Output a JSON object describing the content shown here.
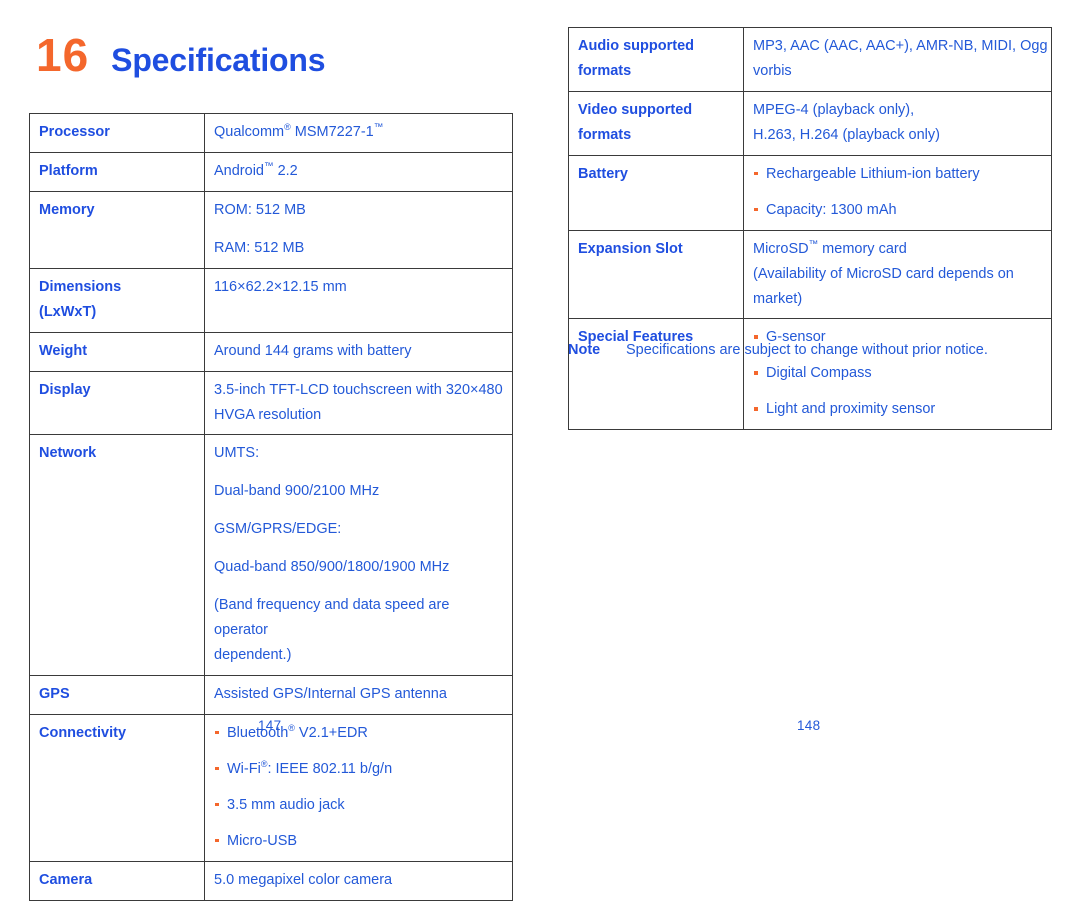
{
  "chapter": {
    "number": "16",
    "title": "Specifications",
    "number_color": "#f4672c",
    "title_color": "#1f4ee0"
  },
  "theme": {
    "text_blue": "#2359d8",
    "label_blue": "#1f4ee0",
    "accent_orange": "#f4672c",
    "border": "#3a3a3a"
  },
  "left_table": {
    "rows": [
      {
        "label": "Processor",
        "lines": [
          "Qualcomm® MSM7227-1™"
        ]
      },
      {
        "label": "Platform",
        "lines": [
          "Android™ 2.2"
        ]
      },
      {
        "label": "Memory",
        "lines": [
          "ROM: 512 MB",
          "RAM: 512 MB"
        ]
      },
      {
        "label": "Dimensions (LxWxT)",
        "label_line1": "Dimensions",
        "label_line2": "(LxWxT)",
        "lines": [
          "116×62.2×12.15 mm"
        ]
      },
      {
        "label": "Weight",
        "lines": [
          "Around 144 grams with battery"
        ]
      },
      {
        "label": "Display",
        "lines": [
          "3.5-inch TFT-LCD touchscreen with 320×480",
          "HVGA resolution"
        ]
      },
      {
        "label": "Network",
        "lines": [
          "UMTS:",
          "Dual-band 900/2100 MHz",
          "GSM/GPRS/EDGE:",
          "Quad-band 850/900/1800/1900 MHz",
          "(Band frequency and data speed are operator",
          "dependent.)"
        ]
      },
      {
        "label": "GPS",
        "lines": [
          "Assisted GPS/Internal GPS antenna"
        ]
      },
      {
        "label": "Connectivity",
        "bullets": [
          "Bluetooth® V2.1+EDR",
          "Wi-Fi®: IEEE 802.11 b/g/n",
          "3.5 mm audio jack",
          "Micro-USB"
        ]
      },
      {
        "label": "Camera",
        "lines": [
          "5.0 megapixel color camera"
        ]
      }
    ]
  },
  "right_table": {
    "rows": [
      {
        "label": "Audio supported formats",
        "label_line1": "Audio supported",
        "label_line2": "formats",
        "lines": [
          "MP3, AAC  (AAC, AAC+), AMR-NB, MIDI, Ogg",
          "vorbis"
        ]
      },
      {
        "label": "Video supported formats",
        "label_line1": "Video supported",
        "label_line2": "formats",
        "lines": [
          "MPEG-4 (playback only),",
          "H.263, H.264 (playback only)"
        ]
      },
      {
        "label": "Battery",
        "bullets": [
          "Rechargeable Lithium-ion battery",
          "Capacity: 1300 mAh"
        ]
      },
      {
        "label": "Expansion Slot",
        "lines": [
          "MicroSD™ memory card",
          "(Availability of MicroSD card depends on",
          "market)"
        ]
      },
      {
        "label": "Special Features",
        "bullets": [
          "G-sensor",
          "Digital Compass",
          "Light and proximity sensor"
        ]
      }
    ]
  },
  "note": {
    "label": "Note",
    "text": "Specifications are subject to change without prior notice."
  },
  "folios": {
    "left": "147",
    "right": "148"
  }
}
